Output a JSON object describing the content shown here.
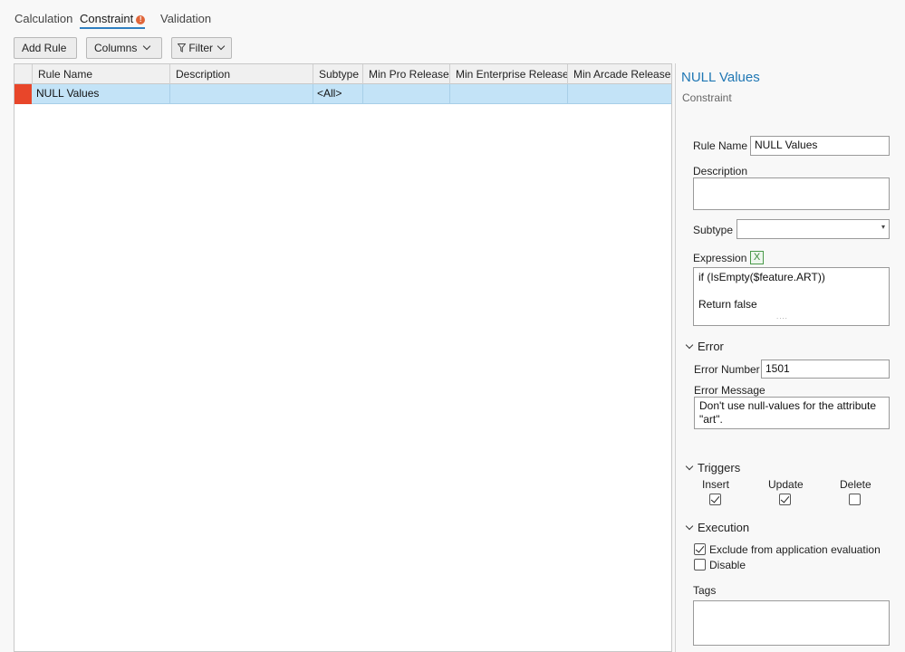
{
  "tabs": [
    {
      "label": "Calculation"
    },
    {
      "label": "Constraint"
    },
    {
      "label": "Validation"
    }
  ],
  "toolbar": {
    "add_rule": "Add Rule",
    "columns": "Columns",
    "filter": "Filter"
  },
  "grid": {
    "columns": [
      "Rule Name",
      "Description",
      "Subtype",
      "Min Pro Release",
      "Min Enterprise Release",
      "Min Arcade Release"
    ],
    "rows": [
      {
        "rule_name": "NULL Values",
        "description": "",
        "subtype": "<All>",
        "min_pro": "",
        "min_enterprise": "",
        "min_arcade": ""
      }
    ]
  },
  "panel": {
    "title": "NULL Values",
    "subtitle": "Constraint",
    "rule_name_label": "Rule Name",
    "rule_name_value": "NULL Values",
    "description_label": "Description",
    "description_value": "",
    "subtype_label": "Subtype",
    "subtype_value": "",
    "expression_label": "Expression",
    "expression_lines": [
      "if (IsEmpty($feature.ART))",
      "Return false"
    ],
    "error_section": "Error",
    "error_number_label": "Error Number",
    "error_number_value": "1501",
    "error_message_label": "Error Message",
    "error_message_value": "Don't use null-values for the attribute \"art\".",
    "triggers_section": "Triggers",
    "trigger_insert": "Insert",
    "trigger_update": "Update",
    "trigger_delete": "Delete",
    "insert_checked": true,
    "update_checked": true,
    "delete_checked": false,
    "execution_section": "Execution",
    "exclude_label": "Exclude from application evaluation",
    "exclude_checked": true,
    "disable_label": "Disable",
    "disable_checked": false,
    "tags_label": "Tags",
    "tags_value": ""
  },
  "colors": {
    "accent": "#2f7fc0",
    "title_blue": "#1f77b4",
    "row_selected": "#c3e3f7",
    "row_marker": "#e8462a",
    "warning": "#e0663a"
  }
}
